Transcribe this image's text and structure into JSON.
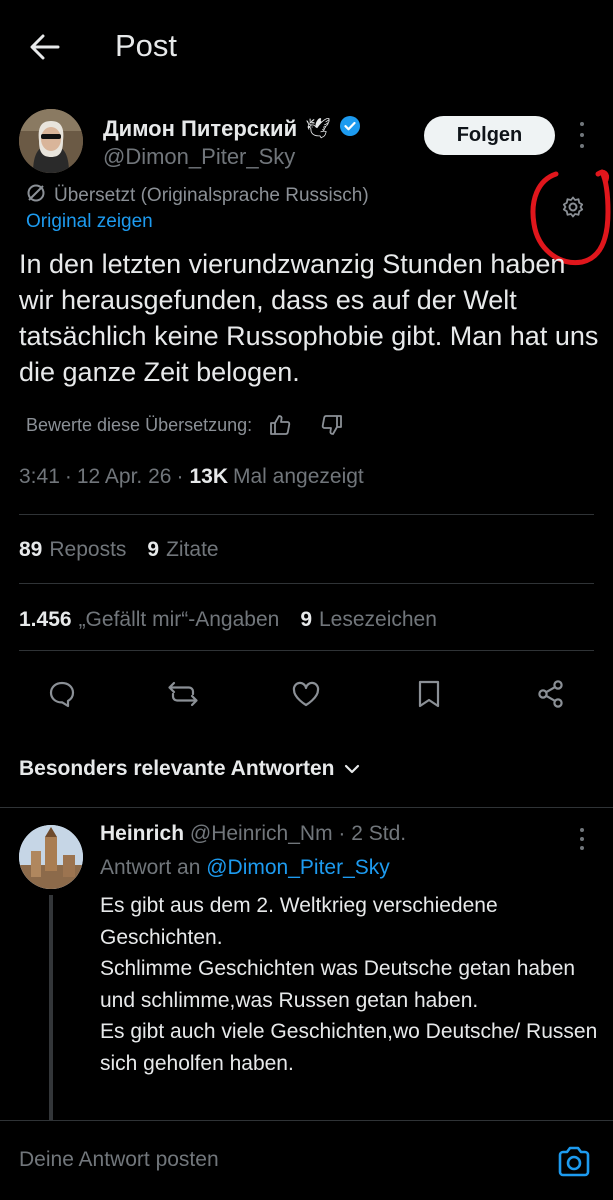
{
  "header": {
    "title": "Post",
    "back_icon": "arrow-left-icon"
  },
  "author": {
    "name": "Димон Питерский",
    "emoji": "🕊",
    "handle": "@Dimon_Piter_Sky",
    "follow_label": "Folgen",
    "verified_color": "#1d9bf0"
  },
  "translation": {
    "status": "Übersetzt (Originalsprache Russisch)",
    "show_original": "Original zeigen",
    "rate_label": "Bewerte diese Übersetzung:"
  },
  "tweet": {
    "text": "In den letzten vierundzwanzig Stunden haben wir herausgefunden, dass es auf der Welt tatsächlich keine Russophobie gibt. Man hat uns die ganze Zeit belogen.",
    "time": "3:41",
    "date": "12 Apr. 26",
    "views_count": "13K",
    "views_label": "Mal angezeigt"
  },
  "stats": {
    "reposts_count": "89",
    "reposts_label": "Reposts",
    "quotes_count": "9",
    "quotes_label": "Zitate",
    "likes_count": "1.456",
    "likes_label": "„Gefällt mir“-Angaben",
    "bookmarks_count": "9",
    "bookmarks_label": "Lesezeichen"
  },
  "actions": [
    "reply-icon",
    "repost-icon",
    "like-icon",
    "bookmark-icon",
    "share-icon"
  ],
  "replies_sort": {
    "label": "Besonders relevante Antworten"
  },
  "reply": {
    "name": "Heinrich",
    "handle": "@Heinrich_Nm",
    "time": "2 Std.",
    "reply_to_prefix": "Antwort an",
    "reply_to_handle": "@Dimon_Piter_Sky",
    "lines": [
      "Es gibt aus dem 2. Weltkrieg verschiedene Geschichten.",
      "Schlimme Geschichten was Deutsche getan haben und schlimme,was Russen getan haben.",
      "Es gibt auch viele Geschichten,wo Deutsche/ Russen sich geholfen haben."
    ]
  },
  "composer": {
    "placeholder": "Deine Antwort posten"
  },
  "colors": {
    "accent": "#1d9bf0",
    "background": "#000000",
    "annotation": "#e0161c"
  }
}
